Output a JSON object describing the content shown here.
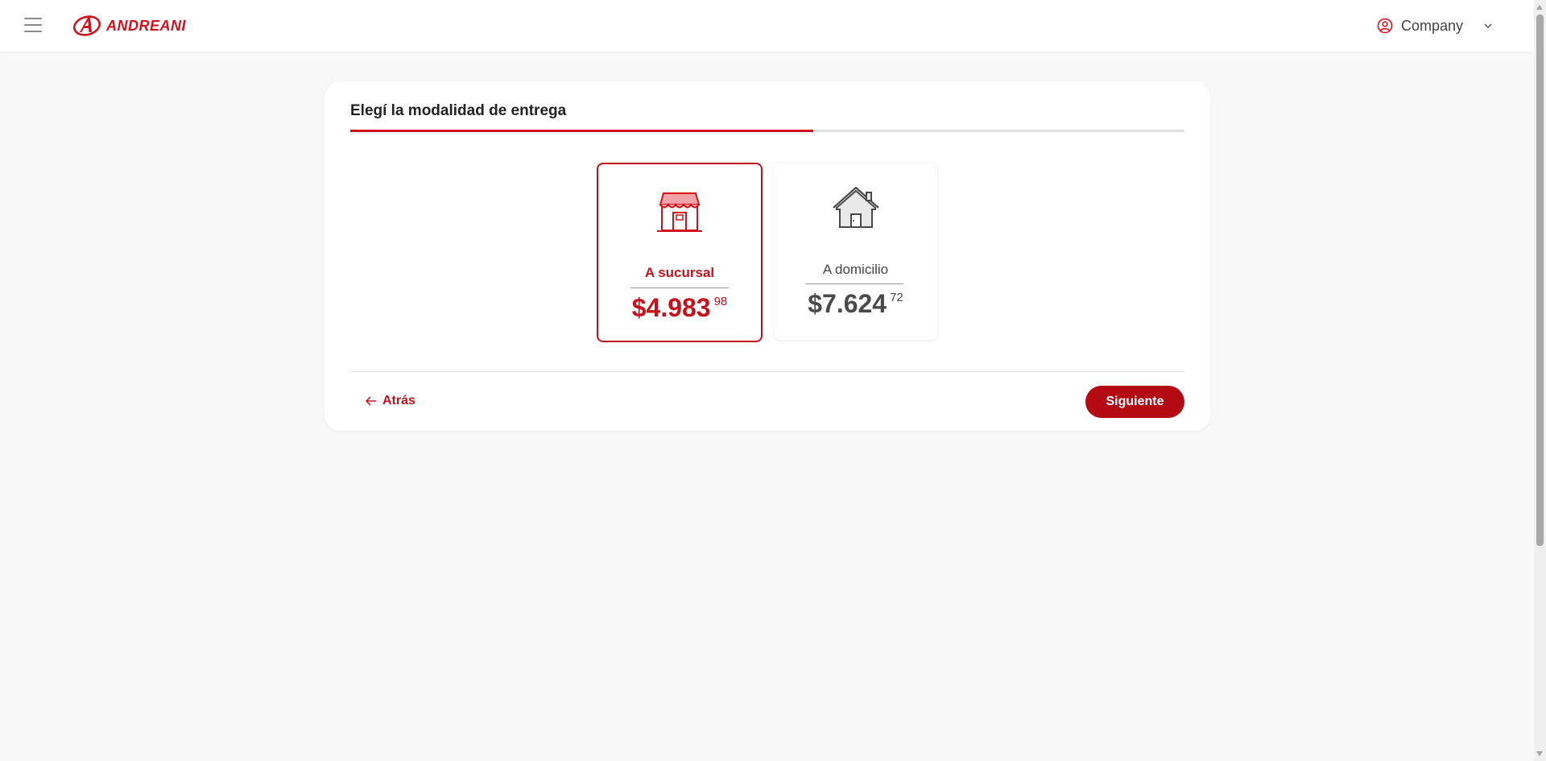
{
  "header": {
    "brand": "ANDREANI",
    "account_name": "Company"
  },
  "card": {
    "title": "Elegí la modalidad de entrega",
    "progress_fraction": 0.555,
    "options": [
      {
        "label": "A sucursal",
        "price_main": "$4.983",
        "price_cents": "98",
        "selected": true
      },
      {
        "label": "A domicilio",
        "price_main": "$7.624",
        "price_cents": "72",
        "selected": false
      }
    ],
    "back_label": "Atrás",
    "next_label": "Siguiente"
  },
  "colors": {
    "brand_red": "#d2111b",
    "button_red": "#b30a14",
    "background": "#f8f8f8"
  },
  "icons": [
    "menu-icon",
    "andreani-logo-icon",
    "user-circle-icon",
    "chevron-down-icon",
    "store-icon",
    "house-icon",
    "arrow-left-icon"
  ]
}
